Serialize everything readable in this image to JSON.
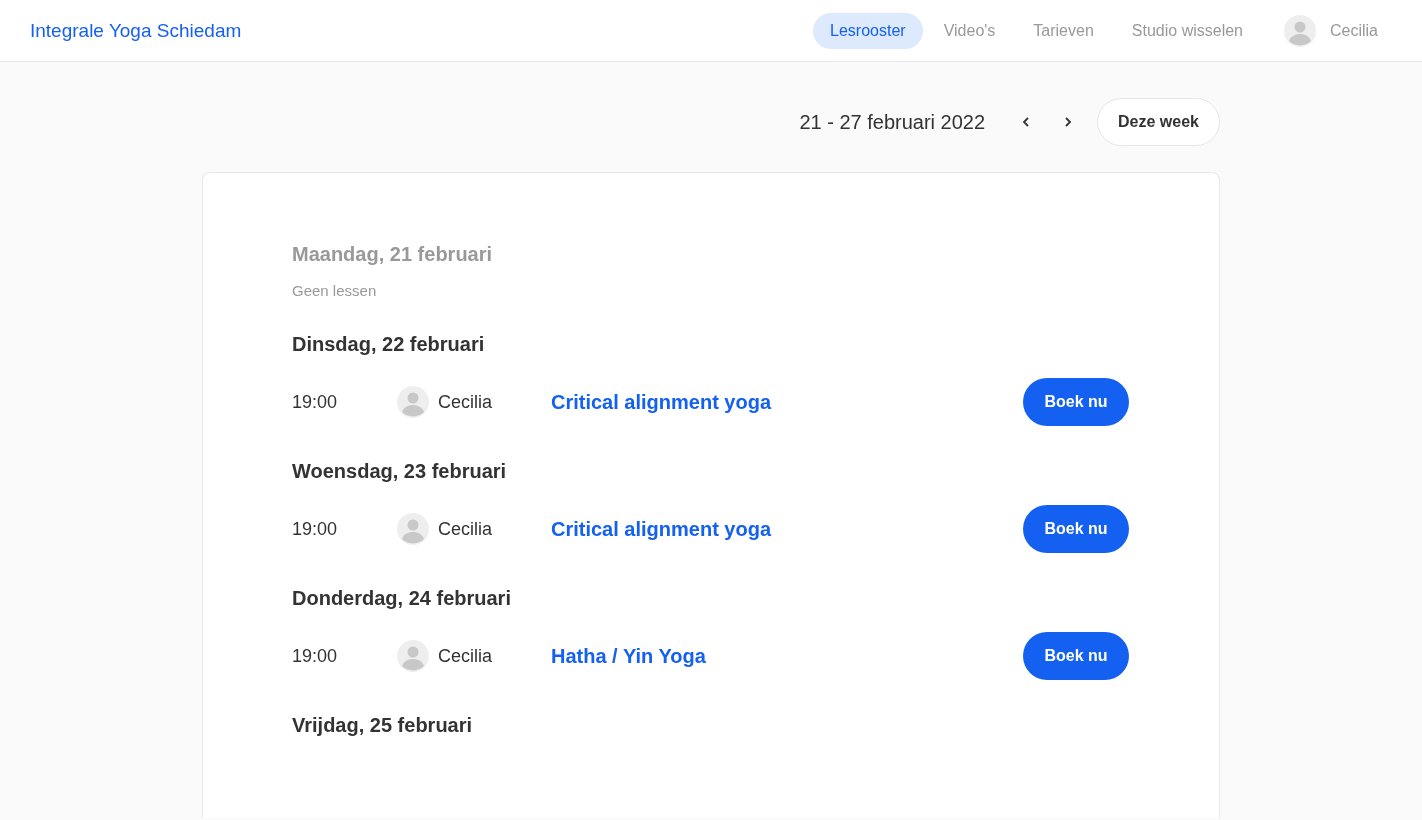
{
  "header": {
    "brand": "Integrale Yoga Schiedam",
    "nav": [
      {
        "label": "Lesrooster",
        "selected": true
      },
      {
        "label": "Video's",
        "selected": false
      },
      {
        "label": "Tarieven",
        "selected": false
      },
      {
        "label": "Studio wisselen",
        "selected": false
      }
    ],
    "user": "Cecilia"
  },
  "week": {
    "range": "21 - 27 februari 2022",
    "today_button": "Deze week"
  },
  "days": [
    {
      "kind": "empty",
      "title": "Maandag, 21 februari",
      "note": "Geen lessen"
    },
    {
      "kind": "classes",
      "title": "Dinsdag, 22 februari",
      "classes": [
        {
          "time": "19:00",
          "teacher": "Cecilia",
          "name": "Critical alignment yoga",
          "button": "Boek nu"
        }
      ]
    },
    {
      "kind": "classes",
      "title": "Woensdag, 23 februari",
      "classes": [
        {
          "time": "19:00",
          "teacher": "Cecilia",
          "name": "Critical alignment yoga",
          "button": "Boek nu"
        }
      ]
    },
    {
      "kind": "classes",
      "title": "Donderdag, 24 februari",
      "classes": [
        {
          "time": "19:00",
          "teacher": "Cecilia",
          "name": "Hatha / Yin Yoga",
          "button": "Boek nu"
        }
      ]
    },
    {
      "kind": "classes",
      "title": "Vrijdag, 25 februari"
    }
  ]
}
